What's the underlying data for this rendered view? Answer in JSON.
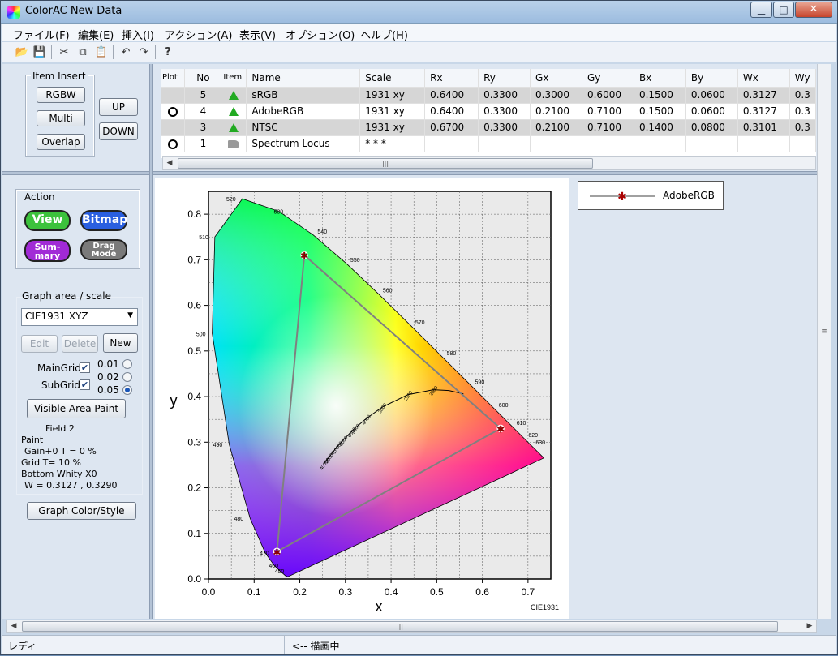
{
  "window": {
    "title": "ColorAC  New Data",
    "minimize": "▁",
    "maximize": "□",
    "close": "✕"
  },
  "menu": [
    "ファイル(F)",
    "編集(E)",
    "挿入(I)",
    "アクション(A)",
    "表示(V)",
    "オプション(O)",
    "ヘルプ(H)"
  ],
  "toolbar": [
    {
      "name": "open-icon",
      "glyph": "📂"
    },
    {
      "name": "save-icon",
      "glyph": "💾"
    },
    {
      "name": "cut-icon",
      "glyph": "✂"
    },
    {
      "name": "copy-icon",
      "glyph": "⧉"
    },
    {
      "name": "paste-icon",
      "glyph": "📋"
    },
    {
      "name": "undo-icon",
      "glyph": "↶"
    },
    {
      "name": "redo-icon",
      "glyph": "↷"
    },
    {
      "name": "help-icon",
      "glyph": "?"
    }
  ],
  "item_insert": {
    "label": "Item Insert",
    "rgbw": "RGBW",
    "multi": "Multi",
    "overlap": "Overlap",
    "up": "UP",
    "down": "DOWN"
  },
  "action": {
    "label": "Action",
    "view": "View",
    "bitmap": "Bitmap",
    "summary": "Sum-mary",
    "drag": "Drag Mode",
    "colors": {
      "view": "#3cc23c",
      "bitmap": "#2a5fe0",
      "summary": "#a12ad6",
      "drag": "#7a7a7a"
    }
  },
  "graph": {
    "label": "Graph area / scale",
    "scale_value": "CIE1931 XYZ",
    "edit": "Edit",
    "delete": "Delete",
    "new": "New",
    "maingrid": "MainGrid",
    "subgrid": "SubGrid",
    "r1": "0.01",
    "r2": "0.02",
    "r3": "0.05",
    "paint_btn": "Visible Area Paint",
    "field": "Field 2",
    "paint": "Paint",
    "gain": "Gain+0  T =   0 %",
    "gridt": "Grid T= 10 %",
    "bottom": "Bottom  Whity X0",
    "w": "W = 0.3127 , 0.3290",
    "style_btn": "Graph Color/Style"
  },
  "table": {
    "headers": [
      "Plot",
      "No",
      "Item",
      "Name",
      "Scale",
      "Rx",
      "Ry",
      "Gx",
      "Gy",
      "Bx",
      "By",
      "Wx",
      "Wy"
    ],
    "rows": [
      {
        "plot": "",
        "no": "5",
        "name": "sRGB",
        "scale": "1931 xy",
        "rx": "0.6400",
        "ry": "0.3300",
        "gx": "0.3000",
        "gy": "0.6000",
        "bx": "0.1500",
        "by": "0.0600",
        "wx": "0.3127",
        "wy": "0.3",
        "sel": true
      },
      {
        "plot": "O",
        "no": "4",
        "name": "AdobeRGB",
        "scale": "1931 xy",
        "rx": "0.6400",
        "ry": "0.3300",
        "gx": "0.2100",
        "gy": "0.7100",
        "bx": "0.1500",
        "by": "0.0600",
        "wx": "0.3127",
        "wy": "0.3",
        "sel": false
      },
      {
        "plot": "",
        "no": "3",
        "name": "NTSC",
        "scale": "1931 xy",
        "rx": "0.6700",
        "ry": "0.3300",
        "gx": "0.2100",
        "gy": "0.7100",
        "bx": "0.1400",
        "by": "0.0800",
        "wx": "0.3101",
        "wy": "0.3",
        "sel": true
      },
      {
        "plot": "O",
        "no": "1",
        "name": "Spectrum Locus",
        "scale": "* * *",
        "rx": "-",
        "ry": "-",
        "gx": "-",
        "gy": "-",
        "bx": "-",
        "by": "-",
        "wx": "-",
        "wy": "-",
        "sel": false
      }
    ]
  },
  "status": {
    "left": "レディ",
    "right": "<-- 描画中"
  },
  "chart_data": {
    "type": "scatter",
    "title": "",
    "xlabel": "x",
    "ylabel": "y",
    "caption": "CIE1931",
    "xlim": [
      0.0,
      0.75
    ],
    "ylim": [
      0.0,
      0.85
    ],
    "xticks": [
      "0.0",
      "0.1",
      "0.2",
      "0.3",
      "0.4",
      "0.5",
      "0.6",
      "0.7"
    ],
    "yticks": [
      "0.0",
      "0.1",
      "0.2",
      "0.3",
      "0.4",
      "0.5",
      "0.6",
      "0.7",
      "0.8"
    ],
    "grid": true,
    "legend": {
      "position": "outside-right-top",
      "entries": [
        "AdobeRGB"
      ]
    },
    "series": [
      {
        "name": "AdobeRGB",
        "color": "#808080",
        "points": [
          [
            0.64,
            0.33
          ],
          [
            0.21,
            0.71
          ],
          [
            0.15,
            0.06
          ]
        ]
      }
    ],
    "spectrum_locus": [
      [
        0.1741,
        0.005
      ],
      [
        0.1738,
        0.0049
      ],
      [
        0.1689,
        0.0069
      ],
      [
        0.1566,
        0.0177
      ],
      [
        0.144,
        0.0297
      ],
      [
        0.1241,
        0.0578
      ],
      [
        0.0913,
        0.1327
      ],
      [
        0.0454,
        0.295
      ],
      [
        0.0082,
        0.5384
      ],
      [
        0.0139,
        0.7502
      ],
      [
        0.0743,
        0.8338
      ],
      [
        0.1547,
        0.8059
      ],
      [
        0.2296,
        0.7543
      ],
      [
        0.3016,
        0.6923
      ],
      [
        0.3731,
        0.6245
      ],
      [
        0.4441,
        0.5547
      ],
      [
        0.5125,
        0.4866
      ],
      [
        0.5752,
        0.4242
      ],
      [
        0.627,
        0.3725
      ],
      [
        0.6658,
        0.334
      ],
      [
        0.6915,
        0.3083
      ],
      [
        0.7347,
        0.2653
      ]
    ],
    "wavelength_labels": [
      {
        "text": "520",
        "x": 0.074,
        "y": 0.834
      },
      {
        "text": "530",
        "x": 0.155,
        "y": 0.806
      },
      {
        "text": "540",
        "x": 0.23,
        "y": 0.754
      },
      {
        "text": "550",
        "x": 0.302,
        "y": 0.692
      },
      {
        "text": "560",
        "x": 0.373,
        "y": 0.625
      },
      {
        "text": "570",
        "x": 0.444,
        "y": 0.555
      },
      {
        "text": "580",
        "x": 0.513,
        "y": 0.487
      },
      {
        "text": "590",
        "x": 0.575,
        "y": 0.424
      },
      {
        "text": "600",
        "x": 0.627,
        "y": 0.373
      },
      {
        "text": "610",
        "x": 0.666,
        "y": 0.334
      },
      {
        "text": "620",
        "x": 0.692,
        "y": 0.308
      },
      {
        "text": "630",
        "x": 0.708,
        "y": 0.292
      },
      {
        "text": "510",
        "x": 0.014,
        "y": 0.75
      },
      {
        "text": "500",
        "x": 0.008,
        "y": 0.538
      },
      {
        "text": "490",
        "x": 0.045,
        "y": 0.295
      },
      {
        "text": "480",
        "x": 0.091,
        "y": 0.133
      },
      {
        "text": "470",
        "x": 0.124,
        "y": 0.058
      },
      {
        "text": "460",
        "x": 0.144,
        "y": 0.03
      },
      {
        "text": "450",
        "x": 0.157,
        "y": 0.018
      }
    ],
    "planckian_locus": [
      [
        0.2525,
        0.2522
      ],
      [
        0.2638,
        0.267
      ],
      [
        0.2806,
        0.2883
      ],
      [
        0.2952,
        0.3048
      ],
      [
        0.3138,
        0.3237
      ],
      [
        0.3221,
        0.3318
      ],
      [
        0.3457,
        0.3516
      ],
      [
        0.3805,
        0.3768
      ],
      [
        0.4369,
        0.4041
      ],
      [
        0.4927,
        0.4149
      ],
      [
        0.5267,
        0.4133
      ],
      [
        0.5586,
        0.4058
      ]
    ],
    "planckian_labels": [
      "40000",
      "20000",
      "10000",
      "8000",
      "6500",
      "5000",
      "4000",
      "3000",
      "2500",
      "2000"
    ]
  }
}
